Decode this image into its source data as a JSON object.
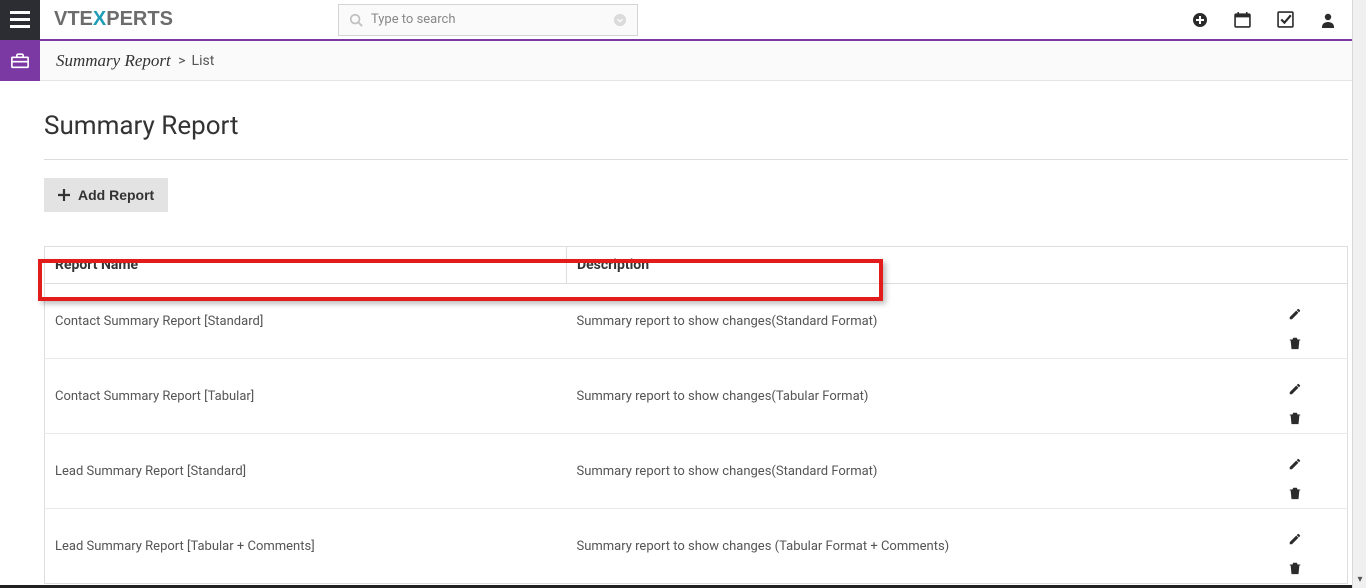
{
  "logo": {
    "pre": "VTE",
    "x": "X",
    "post": "PERTS"
  },
  "search": {
    "placeholder": "Type to search"
  },
  "breadcrumb": {
    "module": "Summary Report",
    "current": "List"
  },
  "page": {
    "title": "Summary Report"
  },
  "buttons": {
    "add_report": "Add Report"
  },
  "table": {
    "headers": {
      "name": "Report Name",
      "description": "Description"
    },
    "rows": [
      {
        "name": "Contact Summary Report [Standard]",
        "description": "Summary report to show changes(Standard Format)"
      },
      {
        "name": "Contact Summary Report [Tabular]",
        "description": "Summary report to show changes(Tabular Format)"
      },
      {
        "name": "Lead Summary Report [Standard]",
        "description": "Summary report to show changes(Standard Format)"
      },
      {
        "name": "Lead Summary Report [Tabular + Comments]",
        "description": "Summary report to show changes (Tabular Format + Comments)"
      }
    ]
  }
}
